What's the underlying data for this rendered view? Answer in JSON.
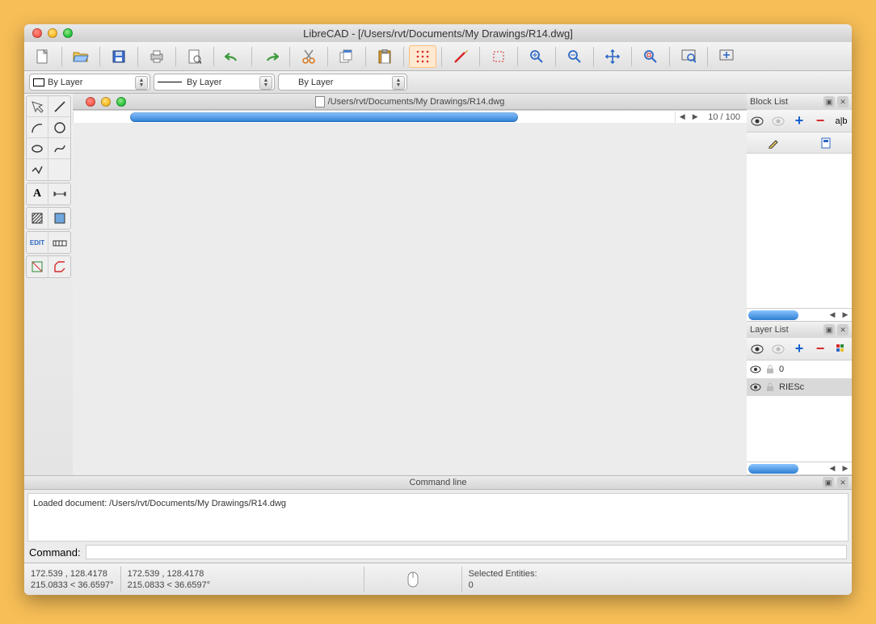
{
  "window": {
    "title": "LibreCAD - [/Users/rvt/Documents/My Drawings/R14.dwg]"
  },
  "document": {
    "title": "/Users/rvt/Documents/My Drawings/R14.dwg"
  },
  "properties": {
    "layer_combo": "By Layer",
    "color_combo": "By Layer",
    "linetype_combo": "By Layer"
  },
  "toolbar_icons": {
    "new": "new-file",
    "open": "open-file",
    "save": "save-file",
    "print": "print",
    "preview": "print-preview",
    "undo": "undo",
    "redo": "redo",
    "cut": "cut",
    "copy": "copy",
    "paste": "paste",
    "grid": "grid-dots",
    "draft": "draft-mode",
    "select_window": "select-window",
    "zoom_in": "zoom-in",
    "zoom_out": "zoom-out",
    "zoom_pan": "pan",
    "zoom_auto": "zoom-auto",
    "zoom_window": "zoom-window",
    "zoom_previous": "zoom-previous"
  },
  "left_tools": {
    "group1": [
      "select",
      "line",
      "arc",
      "circle",
      "ellipse",
      "spline",
      "polyline"
    ],
    "group2": [
      "text",
      "dimension"
    ],
    "group3": [
      "hatch",
      "image"
    ],
    "group4": [
      "modify",
      "snap"
    ],
    "group5": [
      "info",
      "block"
    ]
  },
  "canvas": {
    "grid_label": "10 / 100"
  },
  "block_list": {
    "title": "Block List",
    "items": []
  },
  "layer_list": {
    "title": "Layer List",
    "layers": [
      {
        "name": "0",
        "visible": true,
        "locked": true,
        "selected": false
      },
      {
        "name": "RIESc",
        "visible": true,
        "locked": true,
        "selected": true
      }
    ]
  },
  "command": {
    "title": "Command line",
    "history": "Loaded document: /Users/rvt/Documents/My Drawings/R14.dwg",
    "prompt_label": "Command:",
    "input_value": ""
  },
  "status": {
    "abs_coord": "172.539 , 128.4178",
    "polar_coord": "215.0833 < 36.6597°",
    "rel_abs": "172.539 , 128.4178",
    "rel_polar": "215.0833 < 36.6597°",
    "selected_label": "Selected Entities:",
    "selected_count": "0"
  }
}
